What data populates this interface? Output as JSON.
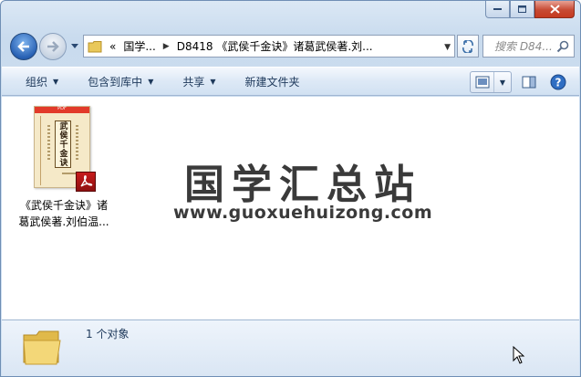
{
  "window": {
    "buttons": {
      "minimize": "minimize",
      "maximize": "maximize",
      "close": "close"
    }
  },
  "nav": {
    "address": {
      "chevron": "«",
      "crumb1": "国学...",
      "crumb2": "D8418 《武侯千金诀》诸葛武侯著.刘..."
    },
    "search_placeholder": "搜索 D84..."
  },
  "toolbar": {
    "organize": "组织",
    "include_in_library": "包含到库中",
    "share": "共享",
    "new_folder": "新建文件夹"
  },
  "file": {
    "name_line1": "《武侯千金诀》诸",
    "name_line2": "葛武侯著.刘伯温...",
    "thumb_badge": "PDF",
    "thumb_title": "武侯千金诀"
  },
  "watermark": {
    "title": "国学汇总站",
    "url": "www.guoxuehuizong.com"
  },
  "details": {
    "count": "1 个对象"
  }
}
